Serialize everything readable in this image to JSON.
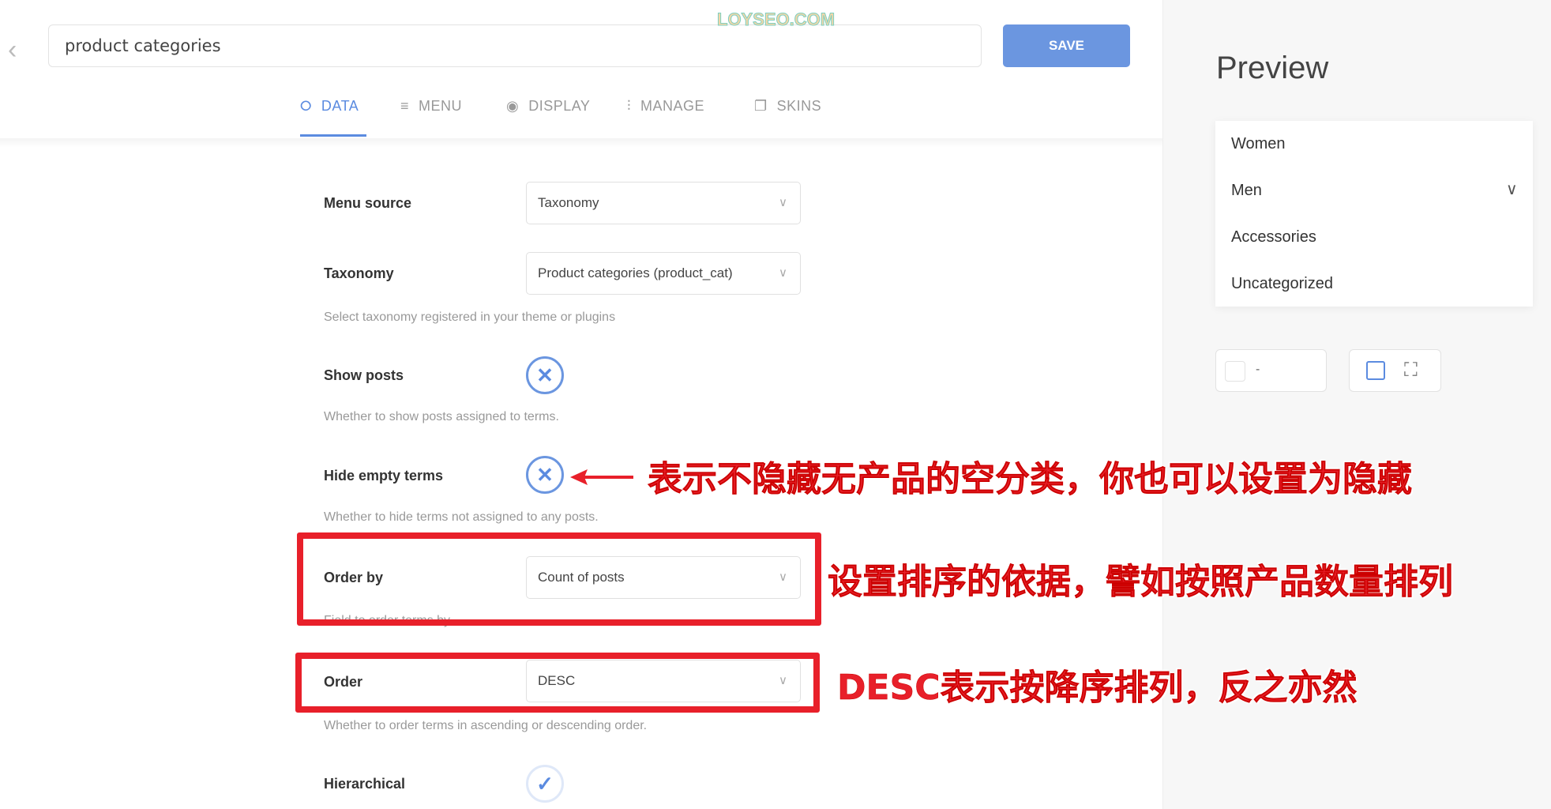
{
  "watermark": "LOYSEO.COM",
  "header": {
    "title_value": "product categories",
    "save_label": "SAVE"
  },
  "tabs": [
    {
      "label": "DATA",
      "icon": "layers-icon"
    },
    {
      "label": "MENU",
      "icon": "menu-icon"
    },
    {
      "label": "DISPLAY",
      "icon": "eye-icon"
    },
    {
      "label": "MANAGE",
      "icon": "sliders-icon"
    },
    {
      "label": "SKINS",
      "icon": "copy-icon"
    }
  ],
  "active_tab": "DATA",
  "accent_color": "#5b8be0",
  "form": {
    "menu_source": {
      "label": "Menu source",
      "value": "Taxonomy"
    },
    "taxonomy": {
      "label": "Taxonomy",
      "value": "Product categories (product_cat)",
      "help": "Select taxonomy registered in your theme or plugins"
    },
    "show_posts": {
      "label": "Show posts",
      "state": "off",
      "help": "Whether to show posts assigned to terms."
    },
    "hide_empty": {
      "label": "Hide empty terms",
      "state": "off",
      "help": "Whether to hide terms not assigned to any posts."
    },
    "order_by": {
      "label": "Order by",
      "value": "Count of posts",
      "help": "Field to order terms by."
    },
    "order": {
      "label": "Order",
      "value": "DESC",
      "help": "Whether to order terms in ascending or descending order."
    },
    "hierarchical": {
      "label": "Hierarchical",
      "state": "on"
    }
  },
  "annotations": {
    "a1": "表示不隐藏无产品的空分类，你也可以设置为隐藏",
    "a2": "设置排序的依据，譬如按照产品数量排列",
    "a3": "DESC表示按降序排列，反之亦然"
  },
  "preview": {
    "title": "Preview",
    "items": [
      "Women",
      "Men",
      "Accessories",
      "Uncategorized"
    ],
    "color_value": "-"
  }
}
